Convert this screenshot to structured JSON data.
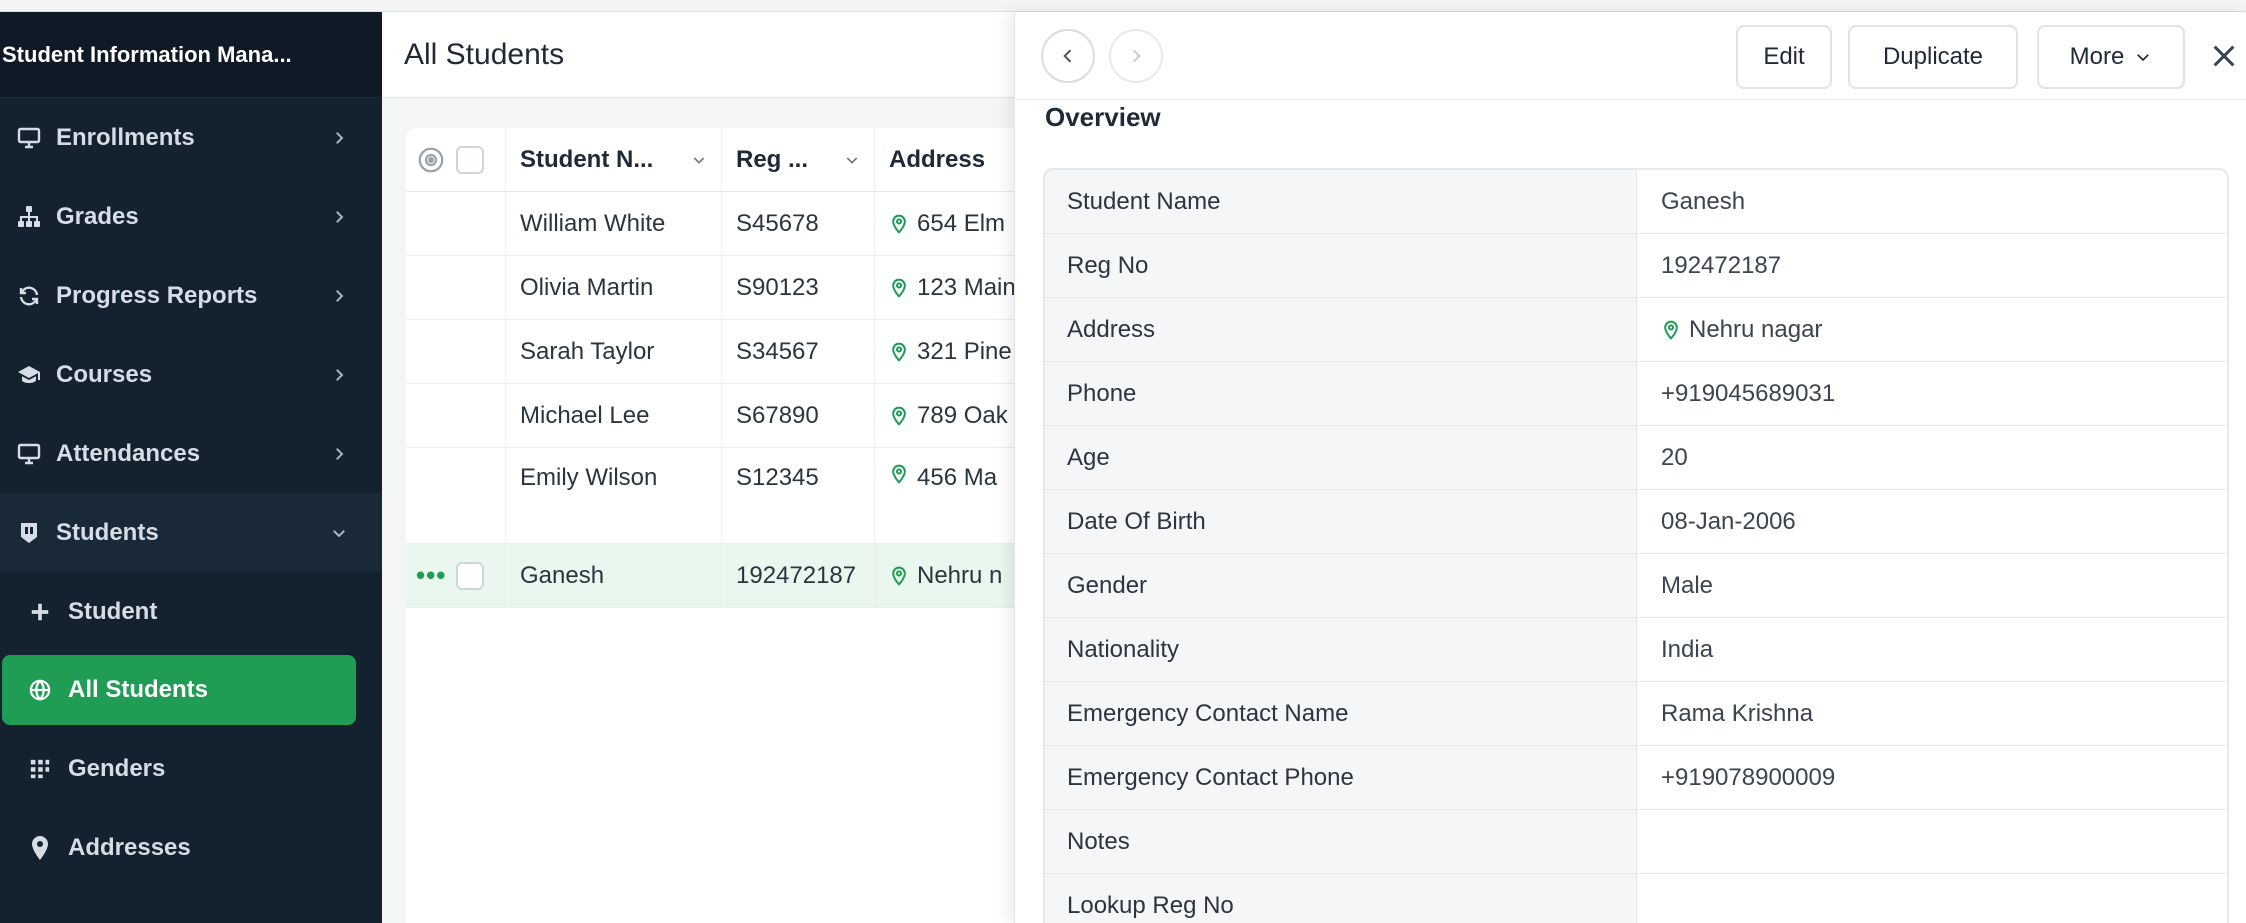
{
  "app": {
    "title": "Student Information Mana..."
  },
  "sidebar": {
    "items": [
      {
        "label": "Enrollments",
        "icon": "monitor-icon"
      },
      {
        "label": "Grades",
        "icon": "sitemap-icon"
      },
      {
        "label": "Progress Reports",
        "icon": "refresh-icon"
      },
      {
        "label": "Courses",
        "icon": "graduation-cap-icon"
      },
      {
        "label": "Attendances",
        "icon": "monitor-icon"
      }
    ],
    "students_group": {
      "label": "Students",
      "icon": "badge-icon",
      "children": [
        {
          "label": "Student",
          "icon": "plus-icon"
        },
        {
          "label": "All Students",
          "icon": "globe-icon"
        },
        {
          "label": "Genders",
          "icon": "grid-icon"
        },
        {
          "label": "Addresses",
          "icon": "map-pin-icon"
        }
      ]
    }
  },
  "list": {
    "title": "All Students",
    "columns": [
      "Student N...",
      "Reg ...",
      "Address"
    ],
    "rows": [
      {
        "name": "William White",
        "reg": "S45678",
        "address": "654 Elm"
      },
      {
        "name": "Olivia Martin",
        "reg": "S90123",
        "address": "123 Main"
      },
      {
        "name": "Sarah Taylor",
        "reg": "S34567",
        "address": "321 Pine"
      },
      {
        "name": "Michael Lee",
        "reg": "S67890",
        "address": "789 Oak"
      },
      {
        "name": "Emily Wilson",
        "reg": "S12345",
        "address": "456 Ma"
      }
    ],
    "selected_row": {
      "name": "Ganesh",
      "reg": "192472187",
      "address": "Nehru n",
      "menu": "•••"
    }
  },
  "detail": {
    "toolbar": {
      "edit": "Edit",
      "duplicate": "Duplicate",
      "more": "More"
    },
    "section_title": "Overview",
    "fields": [
      {
        "key": "Student Name",
        "value": "Ganesh"
      },
      {
        "key": "Reg No",
        "value": "192472187"
      },
      {
        "key": "Address",
        "value": "Nehru nagar"
      },
      {
        "key": "Phone",
        "value": "+919045689031"
      },
      {
        "key": "Age",
        "value": "20"
      },
      {
        "key": "Date Of Birth",
        "value": "08-Jan-2006"
      },
      {
        "key": "Gender",
        "value": "Male"
      },
      {
        "key": "Nationality",
        "value": "India"
      },
      {
        "key": "Emergency Contact Name",
        "value": "Rama Krishna"
      },
      {
        "key": "Emergency Contact Phone",
        "value": "+919078900009"
      },
      {
        "key": "Notes",
        "value": ""
      },
      {
        "key": "Lookup Reg No",
        "value": ""
      }
    ]
  },
  "colors": {
    "accent": "#1f9d55",
    "sidebar": "#14212f",
    "selected_row": "#eaf7ee"
  }
}
